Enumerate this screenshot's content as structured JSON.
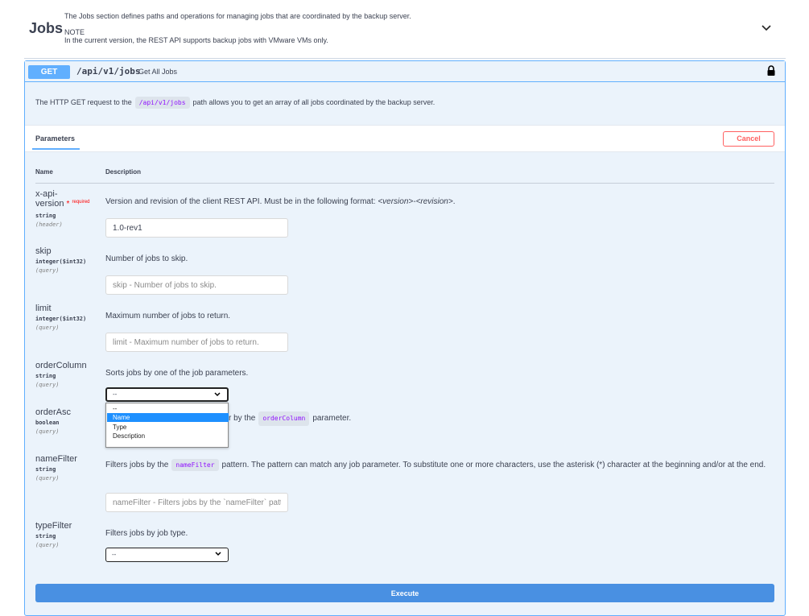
{
  "section": {
    "title": "Jobs",
    "description": "The Jobs section defines paths and operations for managing jobs that are coordinated by the backup server.",
    "note_title": "NOTE",
    "note": "In the current version, the REST API supports backup jobs with VMware VMs only."
  },
  "operation": {
    "method": "GET",
    "path": "/api/v1/jobs",
    "summary": "Get All Jobs",
    "description_pre": "The HTTP GET request to the",
    "description_code": "/api/v1/jobs",
    "description_post": "path allows you to get an array of all jobs coordinated by the backup server."
  },
  "parameters_tab": "Parameters",
  "cancel_label": "Cancel",
  "columns": {
    "name": "Name",
    "description": "Description"
  },
  "params": {
    "xapi": {
      "name_line1": "x-api-",
      "name_line2": "version",
      "required_star": "*",
      "required_label": "required",
      "type": "string",
      "in": "(header)",
      "desc_pre": "Version and revision of the client REST API. Must be in the following format: ",
      "desc_em": "<version>-<revision>",
      "desc_post": ".",
      "value": "1.0-rev1"
    },
    "skip": {
      "name": "skip",
      "type": "integer($int32)",
      "in": "(query)",
      "desc": "Number of jobs to skip.",
      "placeholder": "skip - Number of jobs to skip."
    },
    "limit": {
      "name": "limit",
      "type": "integer($int32)",
      "in": "(query)",
      "desc": "Maximum number of jobs to return.",
      "placeholder": "limit - Maximum number of jobs to return."
    },
    "orderColumn": {
      "name": "orderColumn",
      "type": "string",
      "in": "(query)",
      "desc": "Sorts jobs by one of the job parameters.",
      "selected": "--",
      "options": [
        "--",
        "Name",
        "Type",
        "Description"
      ],
      "highlighted": "Name"
    },
    "orderAsc": {
      "name": "orderAsc",
      "type": "boolean",
      "in": "(query)",
      "desc_visible": "r by the",
      "desc_code": "orderColumn",
      "desc_post": "parameter."
    },
    "nameFilter": {
      "name": "nameFilter",
      "type": "string",
      "in": "(query)",
      "desc_pre": "Filters jobs by the",
      "desc_code": "nameFilter",
      "desc_post": "pattern. The pattern can match any job parameter. To substitute one or more characters, use the asterisk (*) character at the beginning and/or at the end.",
      "placeholder": "nameFilter - Filters jobs by the `nameFilter` pattern."
    },
    "typeFilter": {
      "name": "typeFilter",
      "type": "string",
      "in": "(query)",
      "desc": "Filters jobs by job type.",
      "selected": "--"
    }
  },
  "execute_label": "Execute",
  "colors": {
    "get": "#61affe",
    "cancel": "#ff6060",
    "execute": "#4990e2",
    "required": "#ff0000",
    "code": "#9012fe"
  }
}
